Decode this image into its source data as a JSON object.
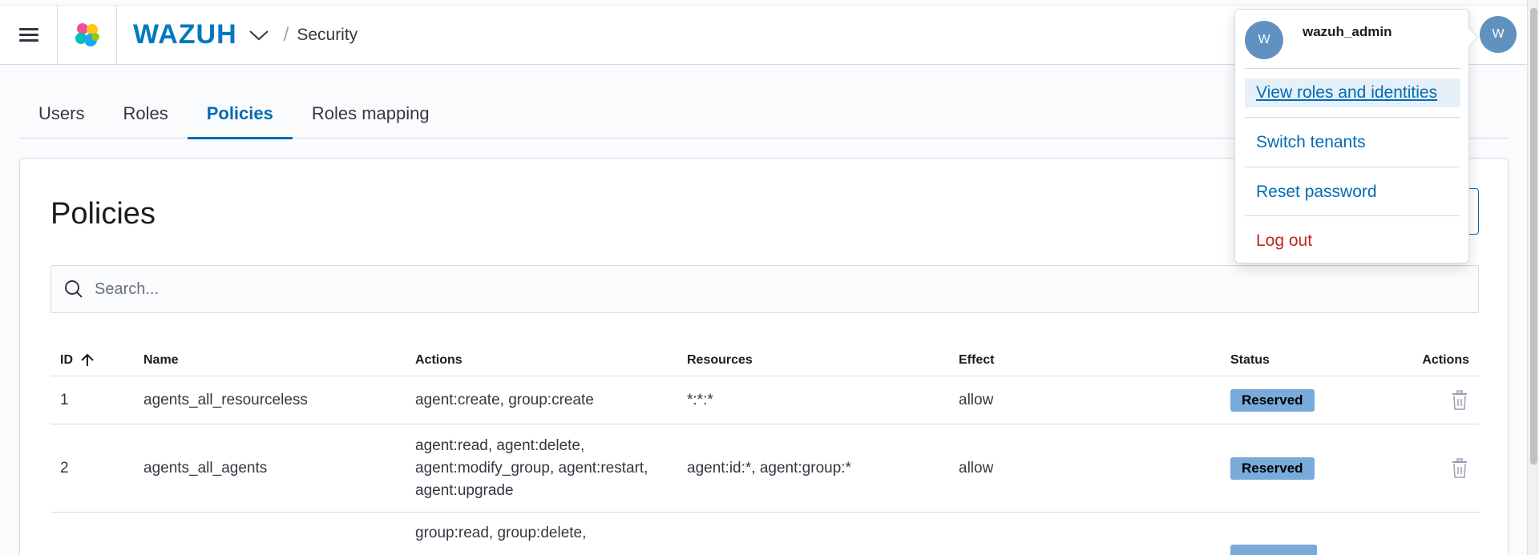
{
  "header": {
    "brand": "WAZUH",
    "breadcrumb_sep": "/",
    "breadcrumb": "Security",
    "avatar_initial": "W"
  },
  "tabs": [
    {
      "label": "Users"
    },
    {
      "label": "Roles"
    },
    {
      "label": "Policies",
      "active": true
    },
    {
      "label": "Roles mapping"
    }
  ],
  "panel": {
    "title": "Policies",
    "search_placeholder": "Search..."
  },
  "table": {
    "columns": {
      "id": "ID",
      "name": "Name",
      "actions": "Actions",
      "resources": "Resources",
      "effect": "Effect",
      "status": "Status",
      "row_actions": "Actions"
    },
    "rows": [
      {
        "id": "1",
        "name": "agents_all_resourceless",
        "actions": "agent:create, group:create",
        "resources": "*:*:*",
        "effect": "allow",
        "status": "Reserved"
      },
      {
        "id": "2",
        "name": "agents_all_agents",
        "actions": "agent:read, agent:delete, agent:modify_group, agent:restart, agent:upgrade",
        "resources": "agent:id:*, agent:group:*",
        "effect": "allow",
        "status": "Reserved"
      },
      {
        "id": "",
        "name": "",
        "actions": "group:read, group:delete,",
        "resources": "",
        "effect": "",
        "status": ""
      }
    ]
  },
  "user_menu": {
    "avatar_initial": "W",
    "username": "wazuh_admin",
    "items": {
      "view_roles": "View roles and identities",
      "switch_tenants": "Switch tenants",
      "reset_password": "Reset password",
      "log_out": "Log out"
    }
  },
  "colors": {
    "primary": "#006bb4",
    "brand": "#0079c1",
    "avatar": "#6092c0",
    "badge": "#79aad9",
    "danger": "#bd271e"
  },
  "icons": {
    "menu": "hamburger-icon",
    "logo": "wazuh-logo-icon",
    "brand_dropdown": "chevron-down-icon",
    "search": "search-icon",
    "sort": "arrow-up-icon",
    "delete": "trash-icon"
  }
}
